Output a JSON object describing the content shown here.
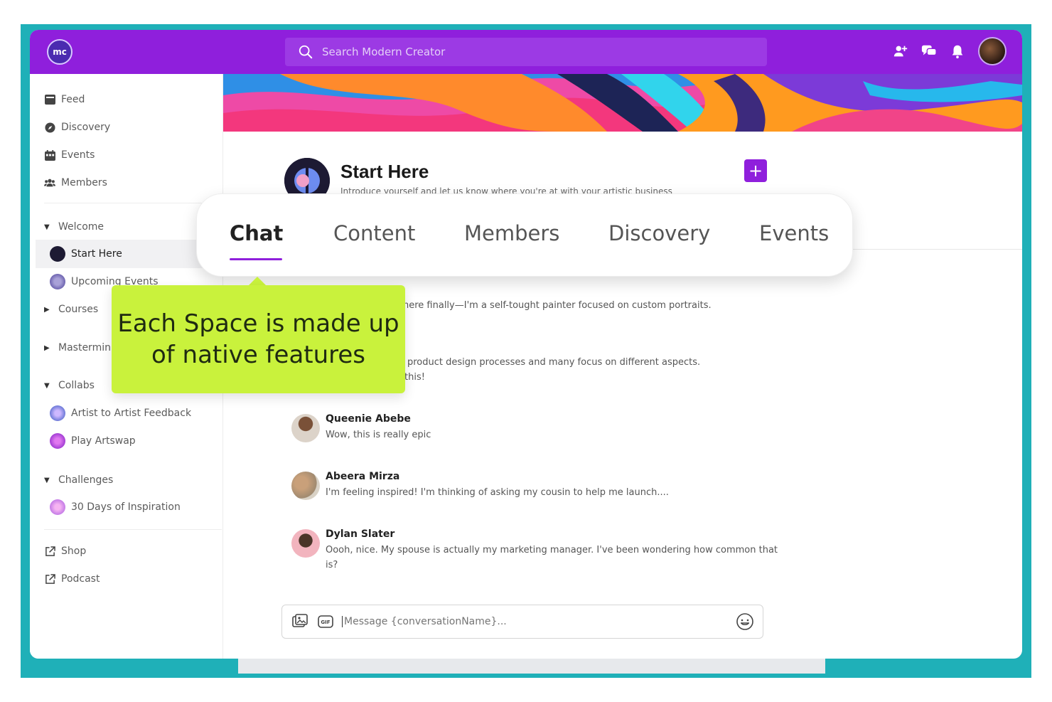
{
  "topbar": {
    "logo_text": "mc",
    "search_placeholder": "Search Modern Creator",
    "icons": [
      "add-user-icon",
      "chat-bubbles-icon",
      "bell-icon",
      "profile-avatar"
    ]
  },
  "sidebar": {
    "nav": [
      {
        "label": "Feed",
        "icon": "feed-icon"
      },
      {
        "label": "Discovery",
        "icon": "compass-icon"
      },
      {
        "label": "Events",
        "icon": "calendar-icon"
      },
      {
        "label": "Members",
        "icon": "members-icon"
      }
    ],
    "welcome_label": "Welcome",
    "start_here": "Start Here",
    "upcoming_events": "Upcoming Events",
    "courses": "Courses",
    "masterminds": "Mastermin",
    "collabs_label": "Collabs",
    "artist_feedback": "Artist to Artist Feedback",
    "play_artswap": "Play Artswap",
    "challenges_label": "Challenges",
    "thirty_days": "30 Days of Inspiration",
    "shop": "Shop",
    "podcast": "Podcast"
  },
  "space": {
    "title": "Start Here",
    "subtitle": "Introduce yourself and let us know where you're at with your artistic business",
    "plus_label": "+"
  },
  "tabs": {
    "chat": "Chat",
    "content": "Content",
    "members": "Members",
    "discovery": "Discovery",
    "events": "Events",
    "active": "Chat"
  },
  "callout": {
    "line1": "Each Space is made up",
    "line2": "of native features"
  },
  "fragments": {
    "frag1": "here finally—I'm a self-tought painter focused on custom portraits.",
    "frag2": "product design processes and many focus on different aspects.",
    "frag3": "this!"
  },
  "messages": [
    {
      "name": "Queenie Abebe",
      "text": "Wow, this is really epic"
    },
    {
      "name": "Abeera Mirza",
      "text": "I'm feeling inspired! I'm thinking of asking my cousin to help me launch...."
    },
    {
      "name": "Dylan Slater",
      "text": "Oooh, nice. My spouse is actually my marketing manager. I've been wondering how common that is?"
    }
  ],
  "composer": {
    "placeholder": "Message {conversationName}..."
  },
  "colors": {
    "brand_purple": "#8f1fdc",
    "callout_green": "#c9f23c",
    "frame_teal": "#1fb0b8"
  }
}
